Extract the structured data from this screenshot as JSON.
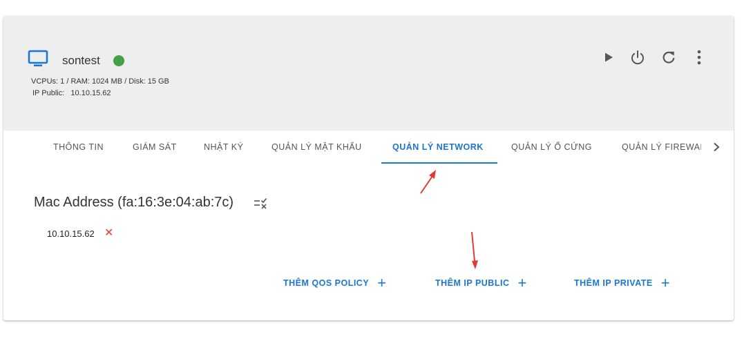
{
  "vm": {
    "name": "sontest",
    "status_color": "#43a047",
    "specs": "VCPUs: 1 / RAM: 1024 MB / Disk: 15 GB",
    "ip_line": "IP Public:   10.10.15.62",
    "icon": "monitor-icon"
  },
  "header_actions": [
    {
      "name": "play-icon"
    },
    {
      "name": "power-icon"
    },
    {
      "name": "refresh-icon"
    },
    {
      "name": "more-vert-icon"
    }
  ],
  "tabs": [
    {
      "label": "THÔNG TIN"
    },
    {
      "label": "GIÁM SÁT"
    },
    {
      "label": "NHẬT KÝ"
    },
    {
      "label": "QUẢN LÝ MẬT KHẨU"
    },
    {
      "label": "QUẢN LÝ NETWORK"
    },
    {
      "label": "QUẢN LÝ Ổ CỨNG"
    },
    {
      "label": "QUẢN LÝ FIREWALL"
    }
  ],
  "active_tab_index": 4,
  "network": {
    "mac_title": "Mac Address (fa:16:3e:04:ab:7c)",
    "ip_address": "10.10.15.62",
    "remove_symbol": "✕"
  },
  "actions": {
    "qos": "THÊM QOS POLICY",
    "public": "THÊM IP PUBLIC",
    "private": "THÊM IP PRIVATE",
    "plus_symbol": "+"
  },
  "colors": {
    "accent": "#1976d2",
    "header_bg": "#eeeeee",
    "danger": "#e53935",
    "annotation_arrow": "#e53935"
  }
}
